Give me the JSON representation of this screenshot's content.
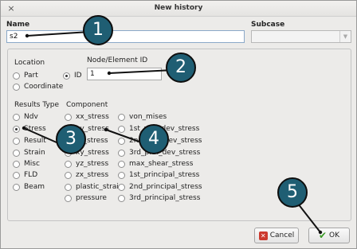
{
  "window": {
    "title": "New history",
    "close_glyph": "×"
  },
  "name": {
    "label": "Name",
    "value": "s2"
  },
  "subcase": {
    "label": "Subcase",
    "value": ""
  },
  "location": {
    "label": "Location",
    "options": [
      "Part",
      "Coordinate",
      "ID"
    ],
    "selected": "ID"
  },
  "node_element": {
    "label": "Node/Element ID",
    "value": "1"
  },
  "results_type": {
    "label": "Results Type",
    "options": [
      "Ndv",
      "Stress",
      "Result",
      "Strain",
      "Misc",
      "FLD",
      "Beam"
    ],
    "selected": "Stress"
  },
  "component": {
    "label": "Component",
    "col1": [
      "xx_stress",
      "yy_stress",
      "zz_stress",
      "xy_stress",
      "yz_stress",
      "zx_stress",
      "plastic_strain",
      "pressure"
    ],
    "col2": [
      "von_mises",
      "1st_prin_dev_stress",
      "2nd_prin_dev_stress",
      "3rd_prin_dev_stress",
      "max_shear_stress",
      "1st_principal_stress",
      "2nd_principal_stress",
      "3rd_principal_stress"
    ],
    "selected": "yy_stress"
  },
  "buttons": {
    "cancel": "Cancel",
    "ok": "OK"
  },
  "callouts": [
    "1",
    "2",
    "3",
    "4",
    "5"
  ],
  "colors": {
    "callout_fill": "#1f5e73",
    "input_focus_border": "#8aa8c8"
  },
  "icons": {
    "combo_arrow": "▼",
    "cancel": "✕",
    "ok": "✔"
  }
}
